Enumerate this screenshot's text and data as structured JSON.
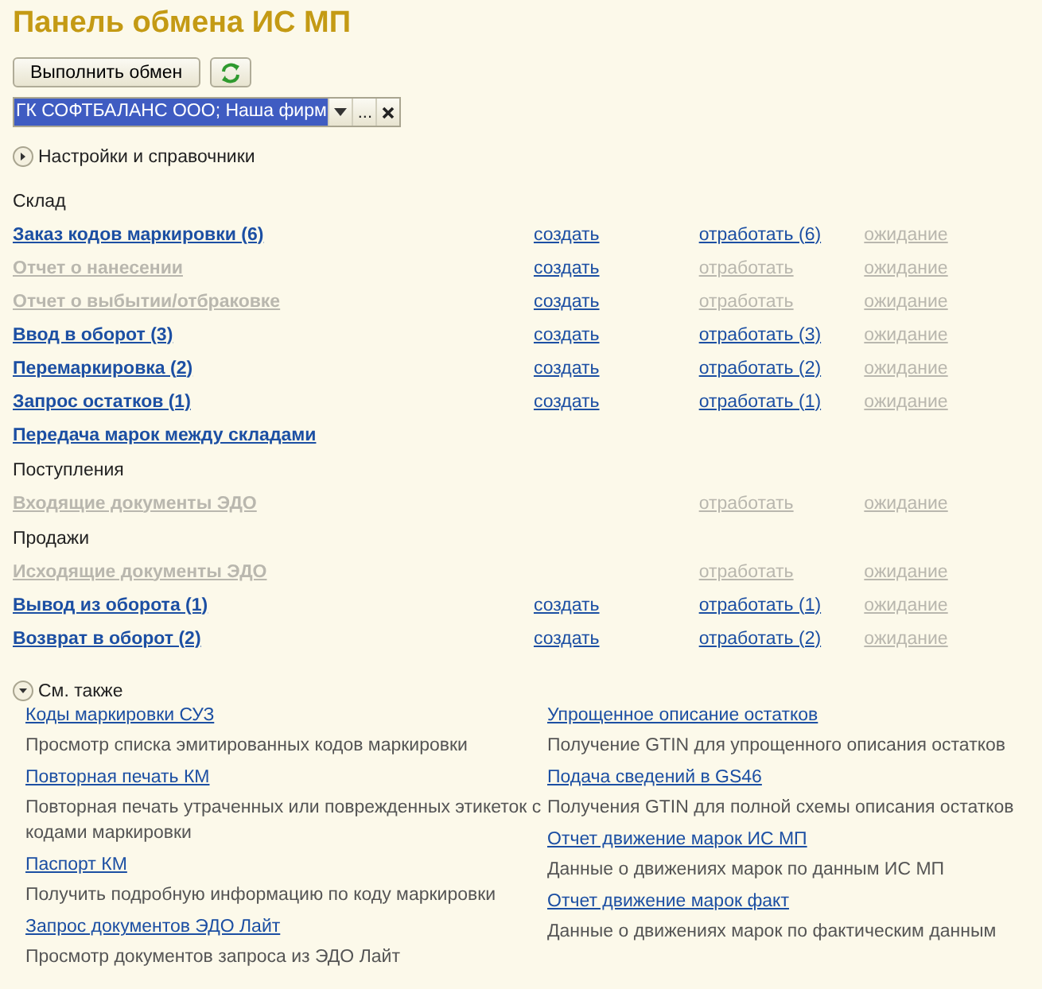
{
  "title": "Панель обмена ИС МП",
  "exchange_button": "Выполнить обмен",
  "company_field": {
    "value": "ГК СОФТБАЛАНС ООО; Наша фирм",
    "highlighted": true,
    "more_button": "..."
  },
  "settings_group": {
    "label": "Настройки и справочники",
    "expanded": false
  },
  "sections": [
    {
      "title": "Склад",
      "rows": [
        {
          "name": {
            "text": "Заказ кодов маркировки (6)",
            "disabled": false
          },
          "create": {
            "text": "создать",
            "disabled": false
          },
          "process": {
            "text": "отработать (6)",
            "disabled": false
          },
          "wait": {
            "text": "ожидание",
            "disabled": true
          }
        },
        {
          "name": {
            "text": "Отчет о нанесении",
            "disabled": true
          },
          "create": {
            "text": "создать",
            "disabled": false
          },
          "process": {
            "text": "отработать",
            "disabled": true
          },
          "wait": {
            "text": "ожидание",
            "disabled": true
          }
        },
        {
          "name": {
            "text": "Отчет о выбытии/отбраковке",
            "disabled": true
          },
          "create": {
            "text": "создать",
            "disabled": false
          },
          "process": {
            "text": "отработать",
            "disabled": true
          },
          "wait": {
            "text": "ожидание",
            "disabled": true
          }
        },
        {
          "name": {
            "text": "Ввод в оборот (3)",
            "disabled": false
          },
          "create": {
            "text": "создать",
            "disabled": false
          },
          "process": {
            "text": "отработать (3)",
            "disabled": false
          },
          "wait": {
            "text": "ожидание",
            "disabled": true
          }
        },
        {
          "name": {
            "text": "Перемаркировка (2)",
            "disabled": false
          },
          "create": {
            "text": "создать",
            "disabled": false
          },
          "process": {
            "text": "отработать (2)",
            "disabled": false
          },
          "wait": {
            "text": "ожидание",
            "disabled": true
          }
        },
        {
          "name": {
            "text": "Запрос остатков (1)",
            "disabled": false
          },
          "create": {
            "text": "создать",
            "disabled": false
          },
          "process": {
            "text": "отработать (1)",
            "disabled": false
          },
          "wait": {
            "text": "ожидание",
            "disabled": true
          }
        },
        {
          "name": {
            "text": "Передача марок между складами",
            "disabled": false
          }
        }
      ]
    },
    {
      "title": "Поступления",
      "rows": [
        {
          "name": {
            "text": "Входящие документы ЭДО",
            "disabled": true
          },
          "process": {
            "text": "отработать",
            "disabled": true
          },
          "wait": {
            "text": "ожидание",
            "disabled": true
          }
        }
      ]
    },
    {
      "title": "Продажи",
      "rows": [
        {
          "name": {
            "text": "Исходящие документы ЭДО",
            "disabled": true
          },
          "process": {
            "text": "отработать",
            "disabled": true
          },
          "wait": {
            "text": "ожидание",
            "disabled": true
          }
        },
        {
          "name": {
            "text": "Вывод из оборота (1)",
            "disabled": false
          },
          "create": {
            "text": "создать",
            "disabled": false
          },
          "process": {
            "text": "отработать (1)",
            "disabled": false
          },
          "wait": {
            "text": "ожидание",
            "disabled": true
          }
        },
        {
          "name": {
            "text": "Возврат в оборот (2)",
            "disabled": false
          },
          "create": {
            "text": "создать",
            "disabled": false
          },
          "process": {
            "text": "отработать (2)",
            "disabled": false
          },
          "wait": {
            "text": "ожидание",
            "disabled": true
          }
        }
      ]
    }
  ],
  "see_also": {
    "label": "См. также",
    "expanded": true,
    "columns": [
      [
        {
          "link": "Коды маркировки СУЗ",
          "description": "Просмотр списка эмитированных кодов маркировки"
        },
        {
          "link": "Повторная печать КМ",
          "description": "Повторная печать утраченных или поврежденных этикеток с кодами маркировки"
        },
        {
          "link": "Паспорт КМ",
          "description": "Получить подробную информацию по коду маркировки"
        },
        {
          "link": "Запрос документов ЭДО Лайт",
          "description": "Просмотр документов запроса из ЭДО Лайт"
        }
      ],
      [
        {
          "link": "Упрощенное описание остатков",
          "description": "Получение GTIN для упрощенного описания остатков"
        },
        {
          "link": "Подача сведений в GS46",
          "description": "Получения GTIN для полной схемы описания остатков"
        },
        {
          "link": "Отчет движение марок ИС МП",
          "description": "Данные о движениях марок по данным ИС МП"
        },
        {
          "link": "Отчет движение марок факт",
          "description": "Данные о движениях марок по фактическим данным"
        }
      ]
    ]
  }
}
